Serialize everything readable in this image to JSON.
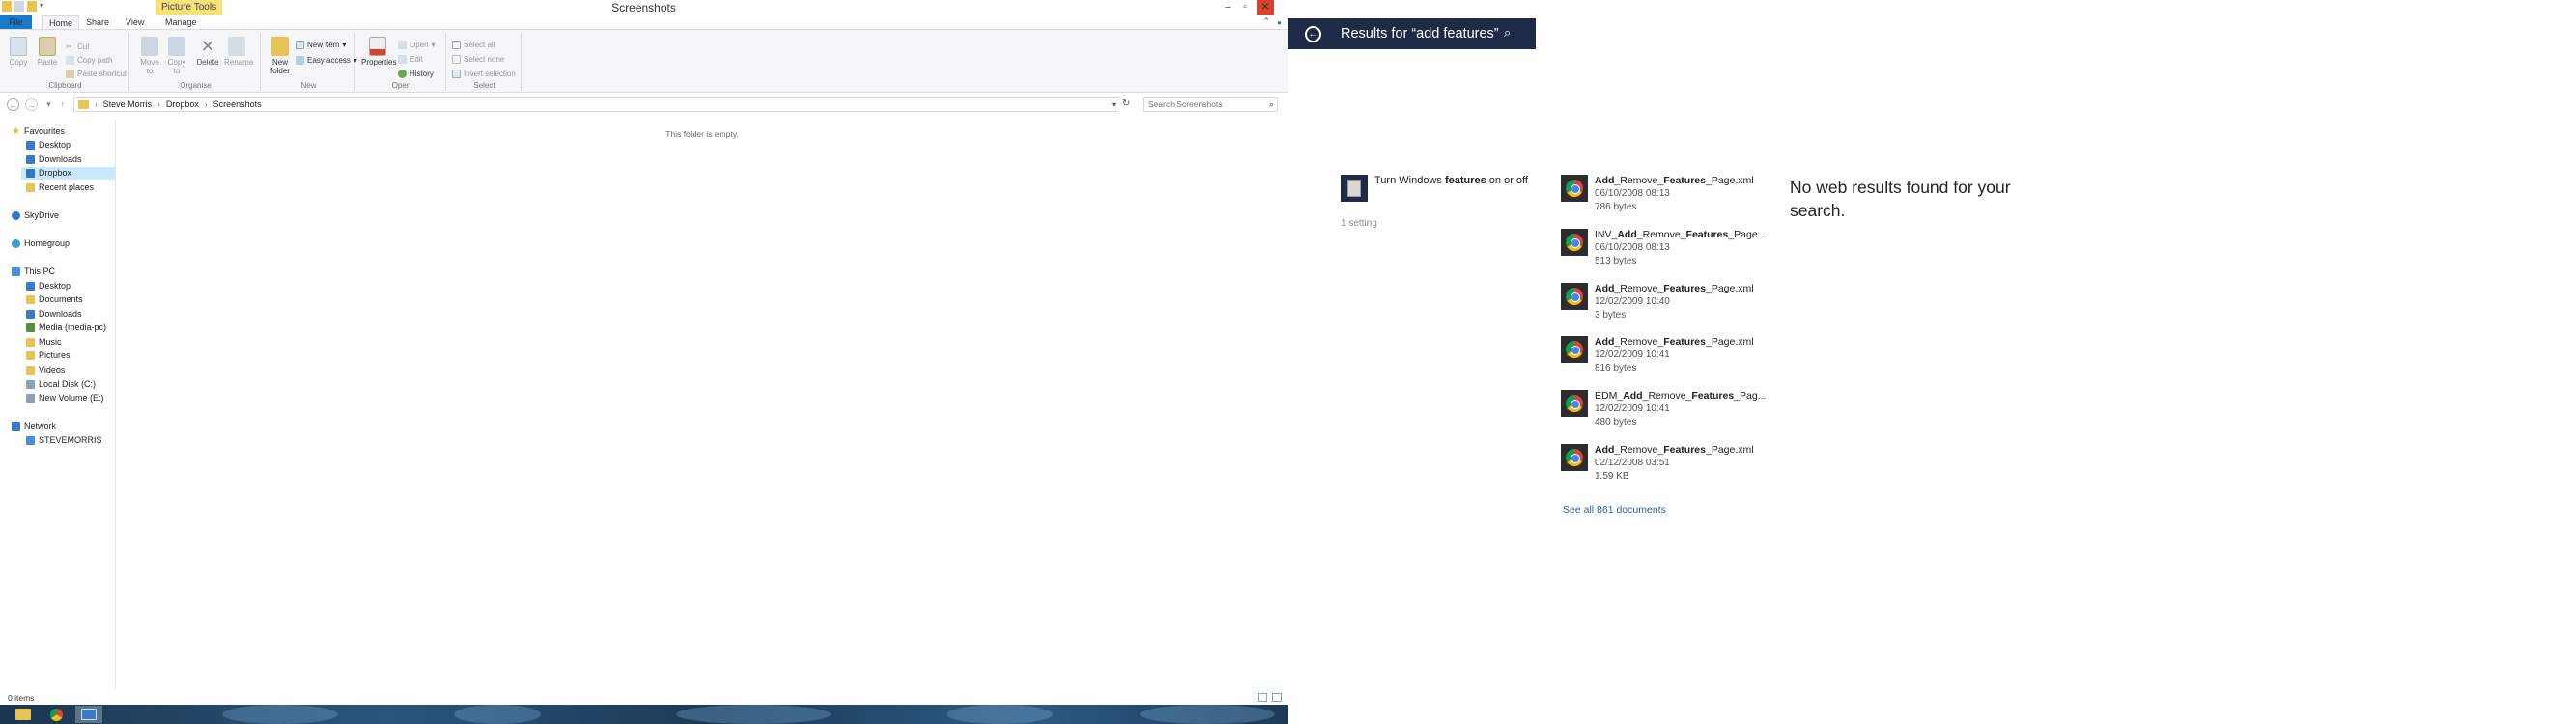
{
  "window": {
    "title": "Screenshots",
    "context_tab": "Picture Tools",
    "minimize": "–",
    "maximize": "▫",
    "close": "✕"
  },
  "ribbon_tabs": {
    "file": "File",
    "home": "Home",
    "share": "Share",
    "view": "View",
    "manage": "Manage"
  },
  "ribbon": {
    "clipboard": {
      "label": "Clipboard",
      "copy": "Copy",
      "paste": "Paste",
      "cut": "Cut",
      "copy_path": "Copy path",
      "paste_shortcut": "Paste shortcut"
    },
    "organise": {
      "label": "Organise",
      "move_to": "Move to",
      "copy_to": "Copy to",
      "delete": "Delete",
      "rename": "Rename"
    },
    "new": {
      "label": "New",
      "new_folder": "New folder",
      "new_item": "New item",
      "easy_access": "Easy access"
    },
    "open": {
      "label": "Open",
      "properties": "Properties",
      "open": "Open",
      "edit": "Edit",
      "history": "History"
    },
    "select": {
      "label": "Select",
      "select_all": "Select all",
      "select_none": "Select none",
      "invert_selection": "Invert selection"
    }
  },
  "address": {
    "crumbs": [
      "Steve Morris",
      "Dropbox",
      "Screenshots"
    ],
    "search_placeholder": "Search Screenshots"
  },
  "nav": {
    "favourites": "Favourites",
    "desktop": "Desktop",
    "downloads": "Downloads",
    "dropbox": "Dropbox",
    "recent_places": "Recent places",
    "skydrive": "SkyDrive",
    "homegroup": "Homegroup",
    "this_pc": "This PC",
    "pc_desktop": "Desktop",
    "pc_documents": "Documents",
    "pc_downloads": "Downloads",
    "pc_media": "Media (media-pc)",
    "pc_music": "Music",
    "pc_pictures": "Pictures",
    "pc_videos": "Videos",
    "pc_local_disk": "Local Disk (C:)",
    "pc_new_volume": "New Volume (E:)",
    "network": "Network",
    "stevemorris": "STEVEMORRIS"
  },
  "content": {
    "empty_message": "This folder is empty."
  },
  "status": {
    "items": "0 items"
  },
  "search": {
    "title": "Results for “add features”",
    "setting": {
      "pre": "Turn Windows ",
      "bold": "features",
      "post": " on or off"
    },
    "setting_count": "1 setting",
    "documents": [
      {
        "pre": "",
        "bold1": "Add",
        "mid": "_Remove_",
        "bold2": "Features",
        "post": "_Page.xml",
        "date": "06/10/2008 08:13",
        "size": "786 bytes"
      },
      {
        "pre": "INV_",
        "bold1": "Add",
        "mid": "_Remove_",
        "bold2": "Features",
        "post": "_Page...",
        "date": "06/10/2008 08:13",
        "size": "513 bytes"
      },
      {
        "pre": "",
        "bold1": "Add",
        "mid": "_Remove_",
        "bold2": "Features",
        "post": "_Page.xml",
        "date": "12/02/2009 10:40",
        "size": "3 bytes"
      },
      {
        "pre": "",
        "bold1": "Add",
        "mid": "_Remove_",
        "bold2": "Features",
        "post": "_Page.xml",
        "date": "12/02/2009 10:41",
        "size": "816 bytes"
      },
      {
        "pre": "EDM_",
        "bold1": "Add",
        "mid": "_Remove_",
        "bold2": "Features",
        "post": "_Pag...",
        "date": "12/02/2009 10:41",
        "size": "480 bytes"
      },
      {
        "pre": "",
        "bold1": "Add",
        "mid": "_Remove_",
        "bold2": "Features",
        "post": "_Page.xml",
        "date": "02/12/2008 03:51",
        "size": "1.59 KB"
      }
    ],
    "see_all": "See all 861 documents",
    "web_message": "No web results found for your search."
  },
  "colors": {
    "accent": "#1979ca",
    "search_header": "#1e2b47",
    "link": "#2a63ad",
    "close": "#d6422c"
  }
}
